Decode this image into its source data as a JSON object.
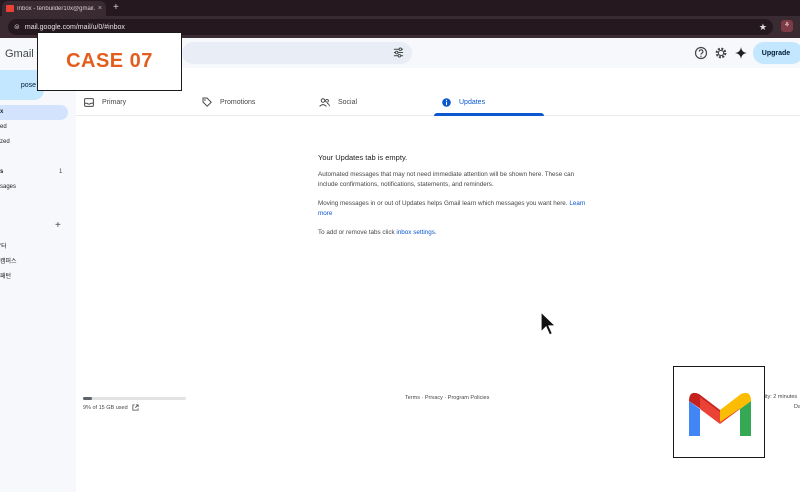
{
  "browser": {
    "tab_title": "Inbox - tenbuilder10x@gmail.",
    "tab_close": "×",
    "new_tab": "+",
    "url": "mail.google.com/mail/u/0/#inbox"
  },
  "gmail": {
    "logo_text": "Gmail",
    "upgrade_label": "Upgrade"
  },
  "sidebar": {
    "compose_label": "pose",
    "items": [
      {
        "label": "x",
        "bold": true
      },
      {
        "label": "ed"
      },
      {
        "label": "zed"
      },
      {
        "label": "s",
        "bold": true,
        "count": "1"
      },
      {
        "label": "sages"
      },
      {
        "label": "'터"
      },
      {
        "label": "캠퍼스"
      },
      {
        "label": "패턴"
      }
    ]
  },
  "categories": {
    "tabs": [
      {
        "label": "Primary",
        "icon": "inbox-icon"
      },
      {
        "label": "Promotions",
        "icon": "tag-icon"
      },
      {
        "label": "Social",
        "icon": "people-icon"
      },
      {
        "label": "Updates",
        "icon": "info-icon",
        "selected": true
      }
    ]
  },
  "empty_state": {
    "title": "Your Updates tab is empty.",
    "para1": "Automated messages that may not need immediate attention will be shown here. These can include confirmations, notifications, statements, and reminders.",
    "para2_text": "Moving messages in or out of Updates helps Gmail learn which messages you want here. ",
    "para2_link": "Learn more",
    "para3_text": "To add or remove tabs click ",
    "para3_link": "inbox settings",
    "para3_end": "."
  },
  "footer": {
    "storage_used": "9% of 15 GB used",
    "storage_fraction": 0.09,
    "links": "Terms · Privacy · Program Policies",
    "activity": "vity: 2 minutes",
    "details": "Da"
  },
  "overlay": {
    "case_label": "CASE 07"
  },
  "colors": {
    "accent": "#0b57d0",
    "case_label": "#e35d1d",
    "upgrade_bg": "#c2e7ff"
  }
}
